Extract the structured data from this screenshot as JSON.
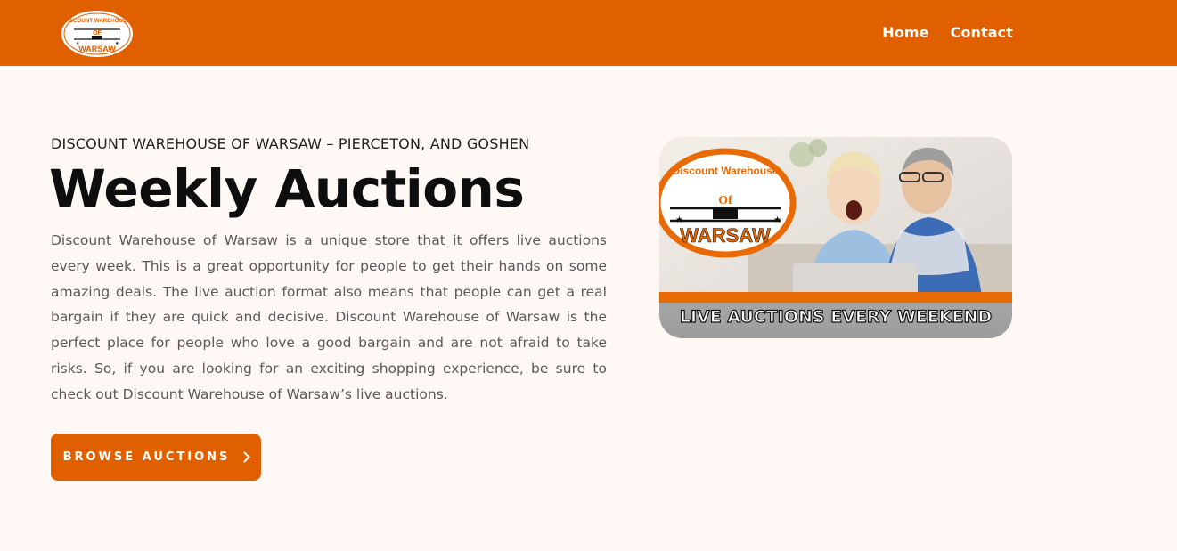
{
  "header": {
    "logo": {
      "top_text": "DISCOUNT WAREHOUSE",
      "middle_text": "OF",
      "bottom_text": "WARSAW"
    },
    "nav": [
      {
        "label": "Home"
      },
      {
        "label": "Contact"
      }
    ]
  },
  "hero": {
    "eyebrow": "DISCOUNT WAREHOUSE OF WARSAW – PIERCETON, AND GOSHEN",
    "title": "Weekly Auctions",
    "description": "Discount Warehouse of Warsaw is a unique store that it offers live auctions every week. This is a great opportunity for people to get their hands on some amazing deals. The live auction format also means that people can get a real bargain if they are quick and decisive. Discount Warehouse of Warsaw is the perfect place for people who love a good bargain and are not afraid to take risks. So, if you are looking for an exciting shopping experience, be sure to check out Discount Warehouse of Warsaw’s live auctions.",
    "cta_label": "BROWSE AUCTIONS",
    "cta_icon": "chevron-right-icon"
  },
  "banner": {
    "caption": "LIVE AUCTIONS EVERY WEEKEND",
    "logo_top_text": "Discount Warehouse",
    "logo_middle_text": "Of",
    "logo_bottom_text": "WARSAW"
  },
  "colors": {
    "brand_orange": "#e06000",
    "page_background": "#fff8f5",
    "text_dark": "#0e0e0e",
    "text_muted": "#5a5a5a"
  }
}
